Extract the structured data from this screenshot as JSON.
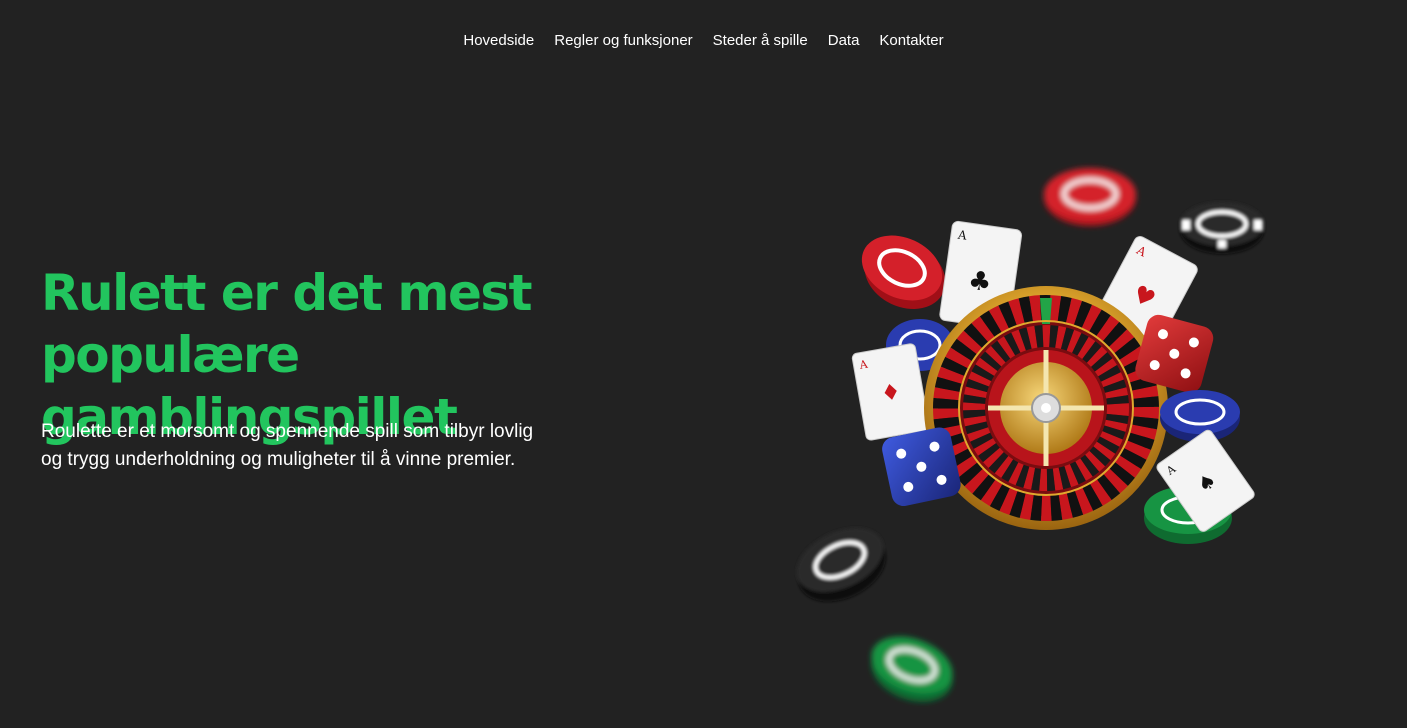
{
  "nav": {
    "items": [
      {
        "label": "Hovedside"
      },
      {
        "label": "Regler og funksjoner"
      },
      {
        "label": "Steder å spille"
      },
      {
        "label": "Data"
      },
      {
        "label": "Kontakter"
      }
    ]
  },
  "hero": {
    "title_line1": "Rulett er det mest",
    "title_line2": "populære gamblingspillet",
    "description_line1": "Roulette er et morsomt og spennende spill som tilbyr lovlig",
    "description_line2": "og trygg underholdning og muligheter til å vinne premier."
  },
  "illustration": {
    "icon": "roulette-casino-illustration",
    "card_rank": "A",
    "colors": {
      "background": "#222222",
      "accent": "#22c55e",
      "wheel_red": "#c8161d",
      "gold": "#e0a82e",
      "chip_blue": "#2a3cb0",
      "chip_green": "#179443"
    }
  }
}
